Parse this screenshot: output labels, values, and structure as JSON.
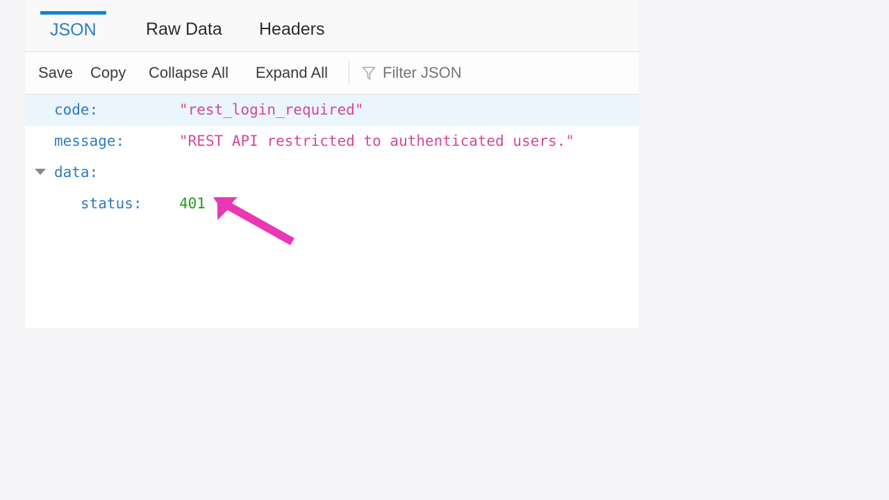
{
  "panel": {
    "tabs": [
      {
        "id": "json",
        "label": "JSON",
        "active": true
      },
      {
        "id": "rawdata",
        "label": "Raw Data",
        "active": false
      },
      {
        "id": "headers",
        "label": "Headers",
        "active": false
      }
    ],
    "toolbar": {
      "save_label": "Save",
      "copy_label": "Copy",
      "collapse_all_label": "Collapse All",
      "expand_all_label": "Expand All",
      "filter_placeholder": "Filter JSON",
      "filter_value": "",
      "filter_icon": "funnel-icon"
    },
    "json_rows": [
      {
        "key": "code:",
        "value": "\"rest_login_required\"",
        "value_type": "string",
        "indent": 0,
        "highlight": true,
        "twisty": false
      },
      {
        "key": "message:",
        "value": "\"REST API restricted to authenticated users.\"",
        "value_type": "string",
        "indent": 0,
        "highlight": false,
        "twisty": false
      },
      {
        "key": "data:",
        "value": "",
        "value_type": "none",
        "indent": 0,
        "highlight": false,
        "twisty": true
      },
      {
        "key": "status:",
        "value": "401",
        "value_type": "number",
        "indent": 1,
        "highlight": false,
        "twisty": false
      }
    ]
  },
  "annotation": {
    "arrow_color": "#ea37b4",
    "arrow_target": "status-value-401"
  },
  "colors": {
    "accent_tab": "#1183d6",
    "active_tab_text": "#2a7ec4",
    "json_key": "#2f7bc0",
    "json_string": "#d3479b",
    "json_number": "#1d9a1d",
    "row_highlight": "#eaf5fc",
    "page_background": "#f5f5f7",
    "panel_background": "#ffffff"
  }
}
